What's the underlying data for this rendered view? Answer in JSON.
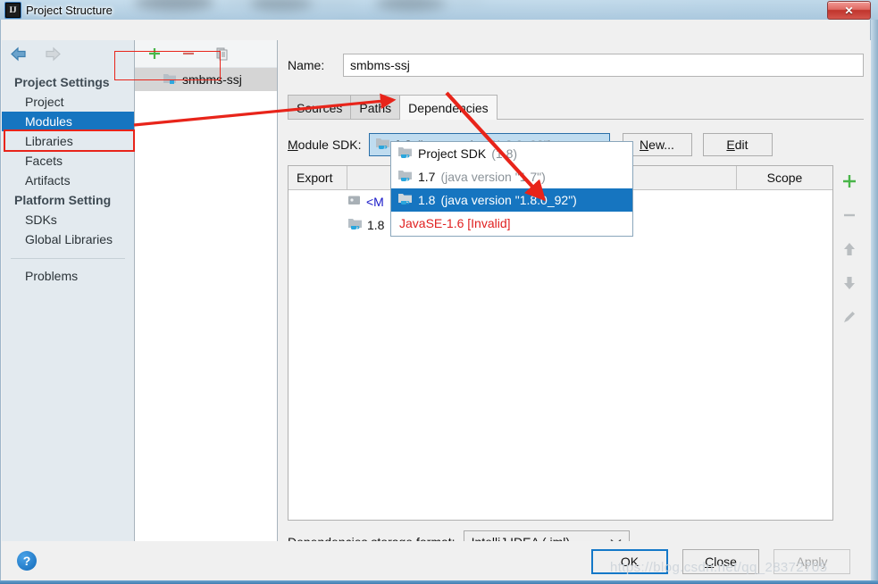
{
  "window": {
    "title": "Project Structure",
    "app_icon": "intellij-idea-icon",
    "close_label": "✕"
  },
  "nav": {
    "back_icon": "back-arrow-icon",
    "forward_icon": "forward-arrow-icon"
  },
  "sidebar": {
    "groups": [
      {
        "label": "Project Settings",
        "items": [
          {
            "label": "Project",
            "selected": false
          },
          {
            "label": "Modules",
            "selected": true
          },
          {
            "label": "Libraries",
            "selected": false
          },
          {
            "label": "Facets",
            "selected": false
          },
          {
            "label": "Artifacts",
            "selected": false
          }
        ]
      },
      {
        "label": "Platform Setting",
        "items": [
          {
            "label": "SDKs",
            "selected": false
          },
          {
            "label": "Global Libraries",
            "selected": false
          }
        ]
      }
    ],
    "extra_items": [
      {
        "label": "Problems",
        "selected": false
      }
    ]
  },
  "module_panel": {
    "toolbar": [
      {
        "icon": "plus-icon",
        "label": "+"
      },
      {
        "icon": "minus-icon",
        "label": "−"
      },
      {
        "icon": "copy-icon",
        "label": "copy"
      }
    ],
    "modules": [
      {
        "label": "smbms-ssj",
        "icon": "module-folder-icon",
        "selected": true
      }
    ]
  },
  "content": {
    "name": {
      "label": "Name:",
      "value": "smbms-ssj",
      "placeholder": ""
    },
    "tabs": [
      {
        "label": "Sources",
        "active": false
      },
      {
        "label": "Paths",
        "active": false
      },
      {
        "label": "Dependencies",
        "active": true
      }
    ],
    "module_sdk": {
      "label": "Module SDK:",
      "selected_name": "1.8",
      "selected_version": "(java version \"1.8.0_92\")",
      "chevron": "⌄",
      "buttons": [
        {
          "label": "New...",
          "name": "new-sdk-button"
        },
        {
          "label": "Edit",
          "name": "edit-sdk-button"
        }
      ],
      "options": [
        {
          "name": "Project SDK",
          "version": "(1.8)",
          "selected": false,
          "invalid": false
        },
        {
          "name": "1.7",
          "version": "(java version \"1.7\")",
          "selected": false,
          "invalid": false
        },
        {
          "name": "1.8",
          "version": "(java version \"1.8.0_92\")",
          "selected": true,
          "invalid": false
        },
        {
          "name": "JavaSE-1.6 [Invalid]",
          "version": "",
          "selected": false,
          "invalid": true
        }
      ]
    },
    "dependencies_table": {
      "columns": [
        {
          "label": "Export"
        },
        {
          "label": ""
        },
        {
          "label": "Scope"
        }
      ],
      "rows": [
        {
          "icon": "module-source-icon",
          "label": "<M",
          "kind": "link"
        },
        {
          "icon": "sdk-icon",
          "label": "1.8",
          "kind": "plain"
        }
      ],
      "side_actions": [
        {
          "icon": "plus-icon",
          "label": "+"
        },
        {
          "icon": "minus-icon",
          "label": "−"
        },
        {
          "icon": "arrow-up-icon",
          "label": "↑"
        },
        {
          "icon": "arrow-down-icon",
          "label": "↓"
        },
        {
          "icon": "edit-pencil-icon",
          "label": "✎"
        }
      ]
    },
    "storage_format": {
      "label": "Dependencies storage format:",
      "value": "IntelliJ IDEA (.iml)",
      "chevron": "⌄"
    }
  },
  "footer": {
    "help_label": "?",
    "buttons": [
      {
        "label": "OK",
        "name": "ok-button",
        "default": true,
        "disabled": false
      },
      {
        "label": "Close",
        "name": "close-dialog-button",
        "default": false,
        "disabled": false
      },
      {
        "label": "Apply",
        "name": "apply-button",
        "default": false,
        "disabled": true
      }
    ]
  },
  "watermark": {
    "text": "https://blog.csdn.net/qq_28372705"
  },
  "colors": {
    "selection_blue": "#1675c0",
    "annotation_red": "#e8241a",
    "invalid_red": "#e02020",
    "link_blue": "#1818c8",
    "combo_border": "#2a6fa8"
  }
}
